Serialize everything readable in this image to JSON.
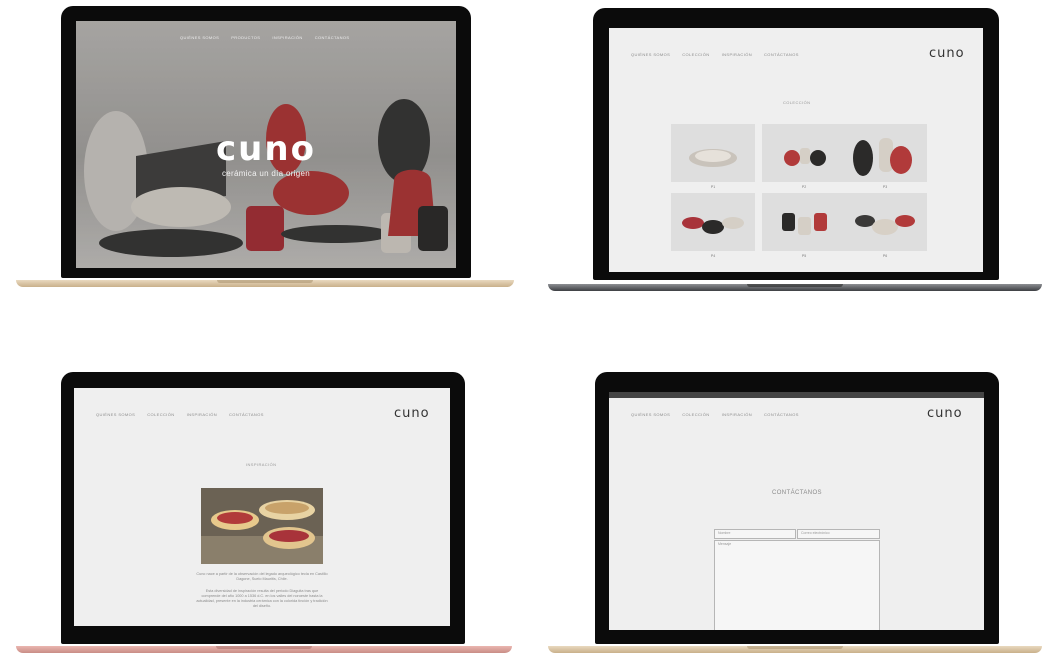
{
  "nav": {
    "items": [
      "QUIÉNES SOMOS",
      "PRODUCTOS",
      "INSPIRACIÓN",
      "CONTÁCTANOS"
    ],
    "items_alt": [
      "QUIÉNES SOMOS",
      "COLECCIÓN",
      "INSPIRACIÓN",
      "CONTÁCTANOS"
    ]
  },
  "brand": {
    "logo": "cuno",
    "tagline": "cerámica un día origen"
  },
  "collection": {
    "title": "COLECCIÓN",
    "items": [
      {
        "code": "P1",
        "color": "#c9c3bb"
      },
      {
        "code": "P2",
        "color": "#b13a3a"
      },
      {
        "code": "P3",
        "color": "#2b2a29"
      },
      {
        "code": "P4",
        "color": "#a8333a"
      },
      {
        "code": "P5",
        "color": "#3a3938"
      },
      {
        "code": "P6",
        "color": "#d7d0c6"
      }
    ]
  },
  "inspiration": {
    "title": "INSPIRACIÓN",
    "paragraph1": "Cuno nace a partir de la observación del legado arqueológico tecla en Castillo Dagone, Suelo Mauritis, Chile.",
    "paragraph2": "Esta diversidad de inspiración resulta del periodo Diaguita tras que comprende del año 1000 a 1536 d.C. en los valles del noroeste hasta la actualidad, presente en la industria cerámica con la colorida tinción y tradición del diseño."
  },
  "contact": {
    "title": "CONTÁCTANOS",
    "name_placeholder": "Nombre",
    "email_placeholder": "Correo electrónico",
    "message_placeholder": "Mensaje"
  },
  "colors": {
    "accent_red": "#b13a3a",
    "dark": "#2b2a29",
    "screen_bg": "#efefef"
  }
}
